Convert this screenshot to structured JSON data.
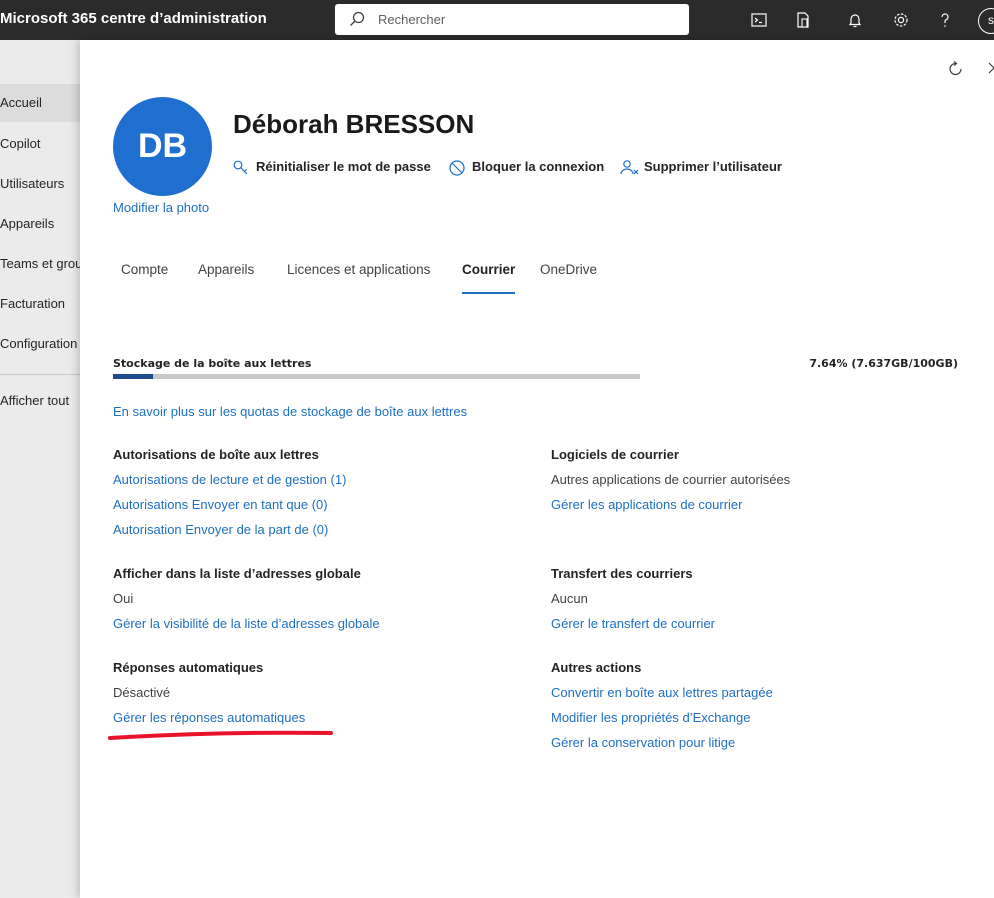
{
  "app": {
    "title": "Microsoft 365 centre d’administration",
    "search_placeholder": "Rechercher",
    "user_initial": "s"
  },
  "sidebar": {
    "items": [
      {
        "label": "Accueil",
        "active": true
      },
      {
        "label": "Copilot"
      },
      {
        "label": "Utilisateurs"
      },
      {
        "label": "Appareils"
      },
      {
        "label": "Teams et groupes"
      },
      {
        "label": "Facturation"
      },
      {
        "label": "Configuration"
      },
      {
        "label": "Afficher tout"
      }
    ]
  },
  "user": {
    "initials": "DB",
    "name": "Déborah BRESSON",
    "edit_photo": "Modifier la photo",
    "actions": [
      {
        "label": "Réinitialiser le mot de passe",
        "icon": "key-icon"
      },
      {
        "label": "Bloquer la connexion",
        "icon": "block-icon"
      },
      {
        "label": "Supprimer l’utilisateur",
        "icon": "remove-user-icon"
      }
    ]
  },
  "tabs": [
    {
      "label": "Compte"
    },
    {
      "label": "Appareils"
    },
    {
      "label": "Licences et applications"
    },
    {
      "label": "Courrier",
      "active": true
    },
    {
      "label": "OneDrive"
    }
  ],
  "storage": {
    "label": "Stockage de la boîte aux lettres",
    "value": "7.64% (7.637GB/100GB)",
    "percent": 7.64,
    "link": "En savoir plus sur les quotas de stockage de boîte aux lettres"
  },
  "sections": {
    "permissions": {
      "title": "Autorisations de boîte aux lettres",
      "links": [
        "Autorisations de lecture et de gestion (1)",
        "Autorisations Envoyer en tant que (0)",
        "Autorisation Envoyer de la part de (0)"
      ]
    },
    "mail_apps": {
      "title": "Logiciels de courrier",
      "text": "Autres applications de courrier autorisées",
      "link": "Gérer les applications de courrier"
    },
    "gal": {
      "title": "Afficher dans la liste d’adresses globale",
      "text": "Oui",
      "link": "Gérer la visibilité de la liste d’adresses globale"
    },
    "forwarding": {
      "title": "Transfert des courriers",
      "text": "Aucun",
      "link": "Gérer le transfert de courrier"
    },
    "auto_replies": {
      "title": "Réponses automatiques",
      "text": "Désactivé",
      "link": "Gérer les réponses automatiques"
    },
    "other_actions": {
      "title": "Autres actions",
      "links": [
        "Convertir en boîte aux lettres partagée",
        "Modifier les propriétés d’Exchange",
        "Gérer la conservation pour litige"
      ]
    }
  },
  "colors": {
    "topbar": "#2b2b2b",
    "accent": "#1f6fc2",
    "avatar": "#1f6fd1",
    "storage_fill": "#1c4c8c",
    "annotation": "#e8132a"
  }
}
